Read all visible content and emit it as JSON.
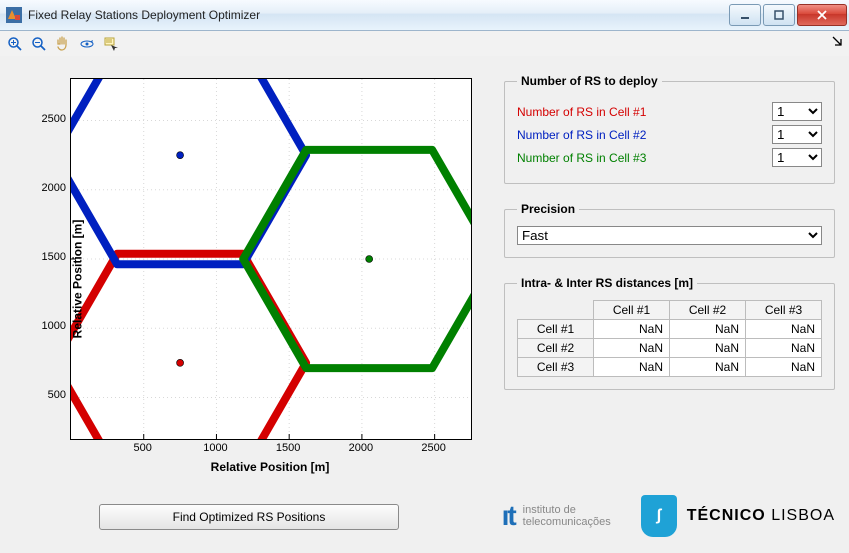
{
  "window": {
    "title": "Fixed Relay Stations Deployment Optimizer"
  },
  "toolbar": {
    "items": [
      "zoom-in",
      "zoom-out",
      "pan",
      "rotate",
      "data-cursor"
    ]
  },
  "deploy": {
    "legend": "Number of RS to deploy",
    "rows": [
      {
        "label": "Number of RS in Cell #1",
        "color": "#d40000",
        "value": "1"
      },
      {
        "label": "Number of RS in Cell #2",
        "color": "#0020c0",
        "value": "1"
      },
      {
        "label": "Number of RS in Cell #3",
        "color": "#008000",
        "value": "1"
      }
    ],
    "options": [
      "1"
    ]
  },
  "precision": {
    "legend": "Precision",
    "value": "Fast"
  },
  "dist": {
    "legend": "Intra- & Inter RS distances [m]",
    "cols": [
      "Cell #1",
      "Cell #2",
      "Cell #3"
    ],
    "rows": [
      "Cell #1",
      "Cell #2",
      "Cell #3"
    ],
    "cells": [
      [
        "NaN",
        "NaN",
        "NaN"
      ],
      [
        "NaN",
        "NaN",
        "NaN"
      ],
      [
        "NaN",
        "NaN",
        "NaN"
      ]
    ]
  },
  "button": {
    "find": "Find Optimized RS Positions"
  },
  "logos": {
    "it": {
      "line1": "instituto de",
      "line2": "telecomunicações"
    },
    "tecnico": {
      "bold": "TÉCNICO",
      "light": "LISBOA",
      "glyph": "ʃ"
    }
  },
  "chart_data": {
    "type": "scatter",
    "xlabel": "Relative Position [m]",
    "ylabel": "Relative Position [m]",
    "xlim": [
      0,
      2750
    ],
    "ylim": [
      200,
      2800
    ],
    "xticks": [
      500,
      1000,
      1500,
      2000,
      2500
    ],
    "yticks": [
      500,
      1000,
      1500,
      2000,
      2500
    ],
    "hex_radius_m": 866,
    "cells": [
      {
        "name": "Cell #1",
        "color": "#d40000",
        "center": [
          750,
          750
        ]
      },
      {
        "name": "Cell #2",
        "color": "#0020c0",
        "center": [
          750,
          2250
        ]
      },
      {
        "name": "Cell #3",
        "color": "#008000",
        "center": [
          2050,
          1500
        ]
      }
    ]
  }
}
